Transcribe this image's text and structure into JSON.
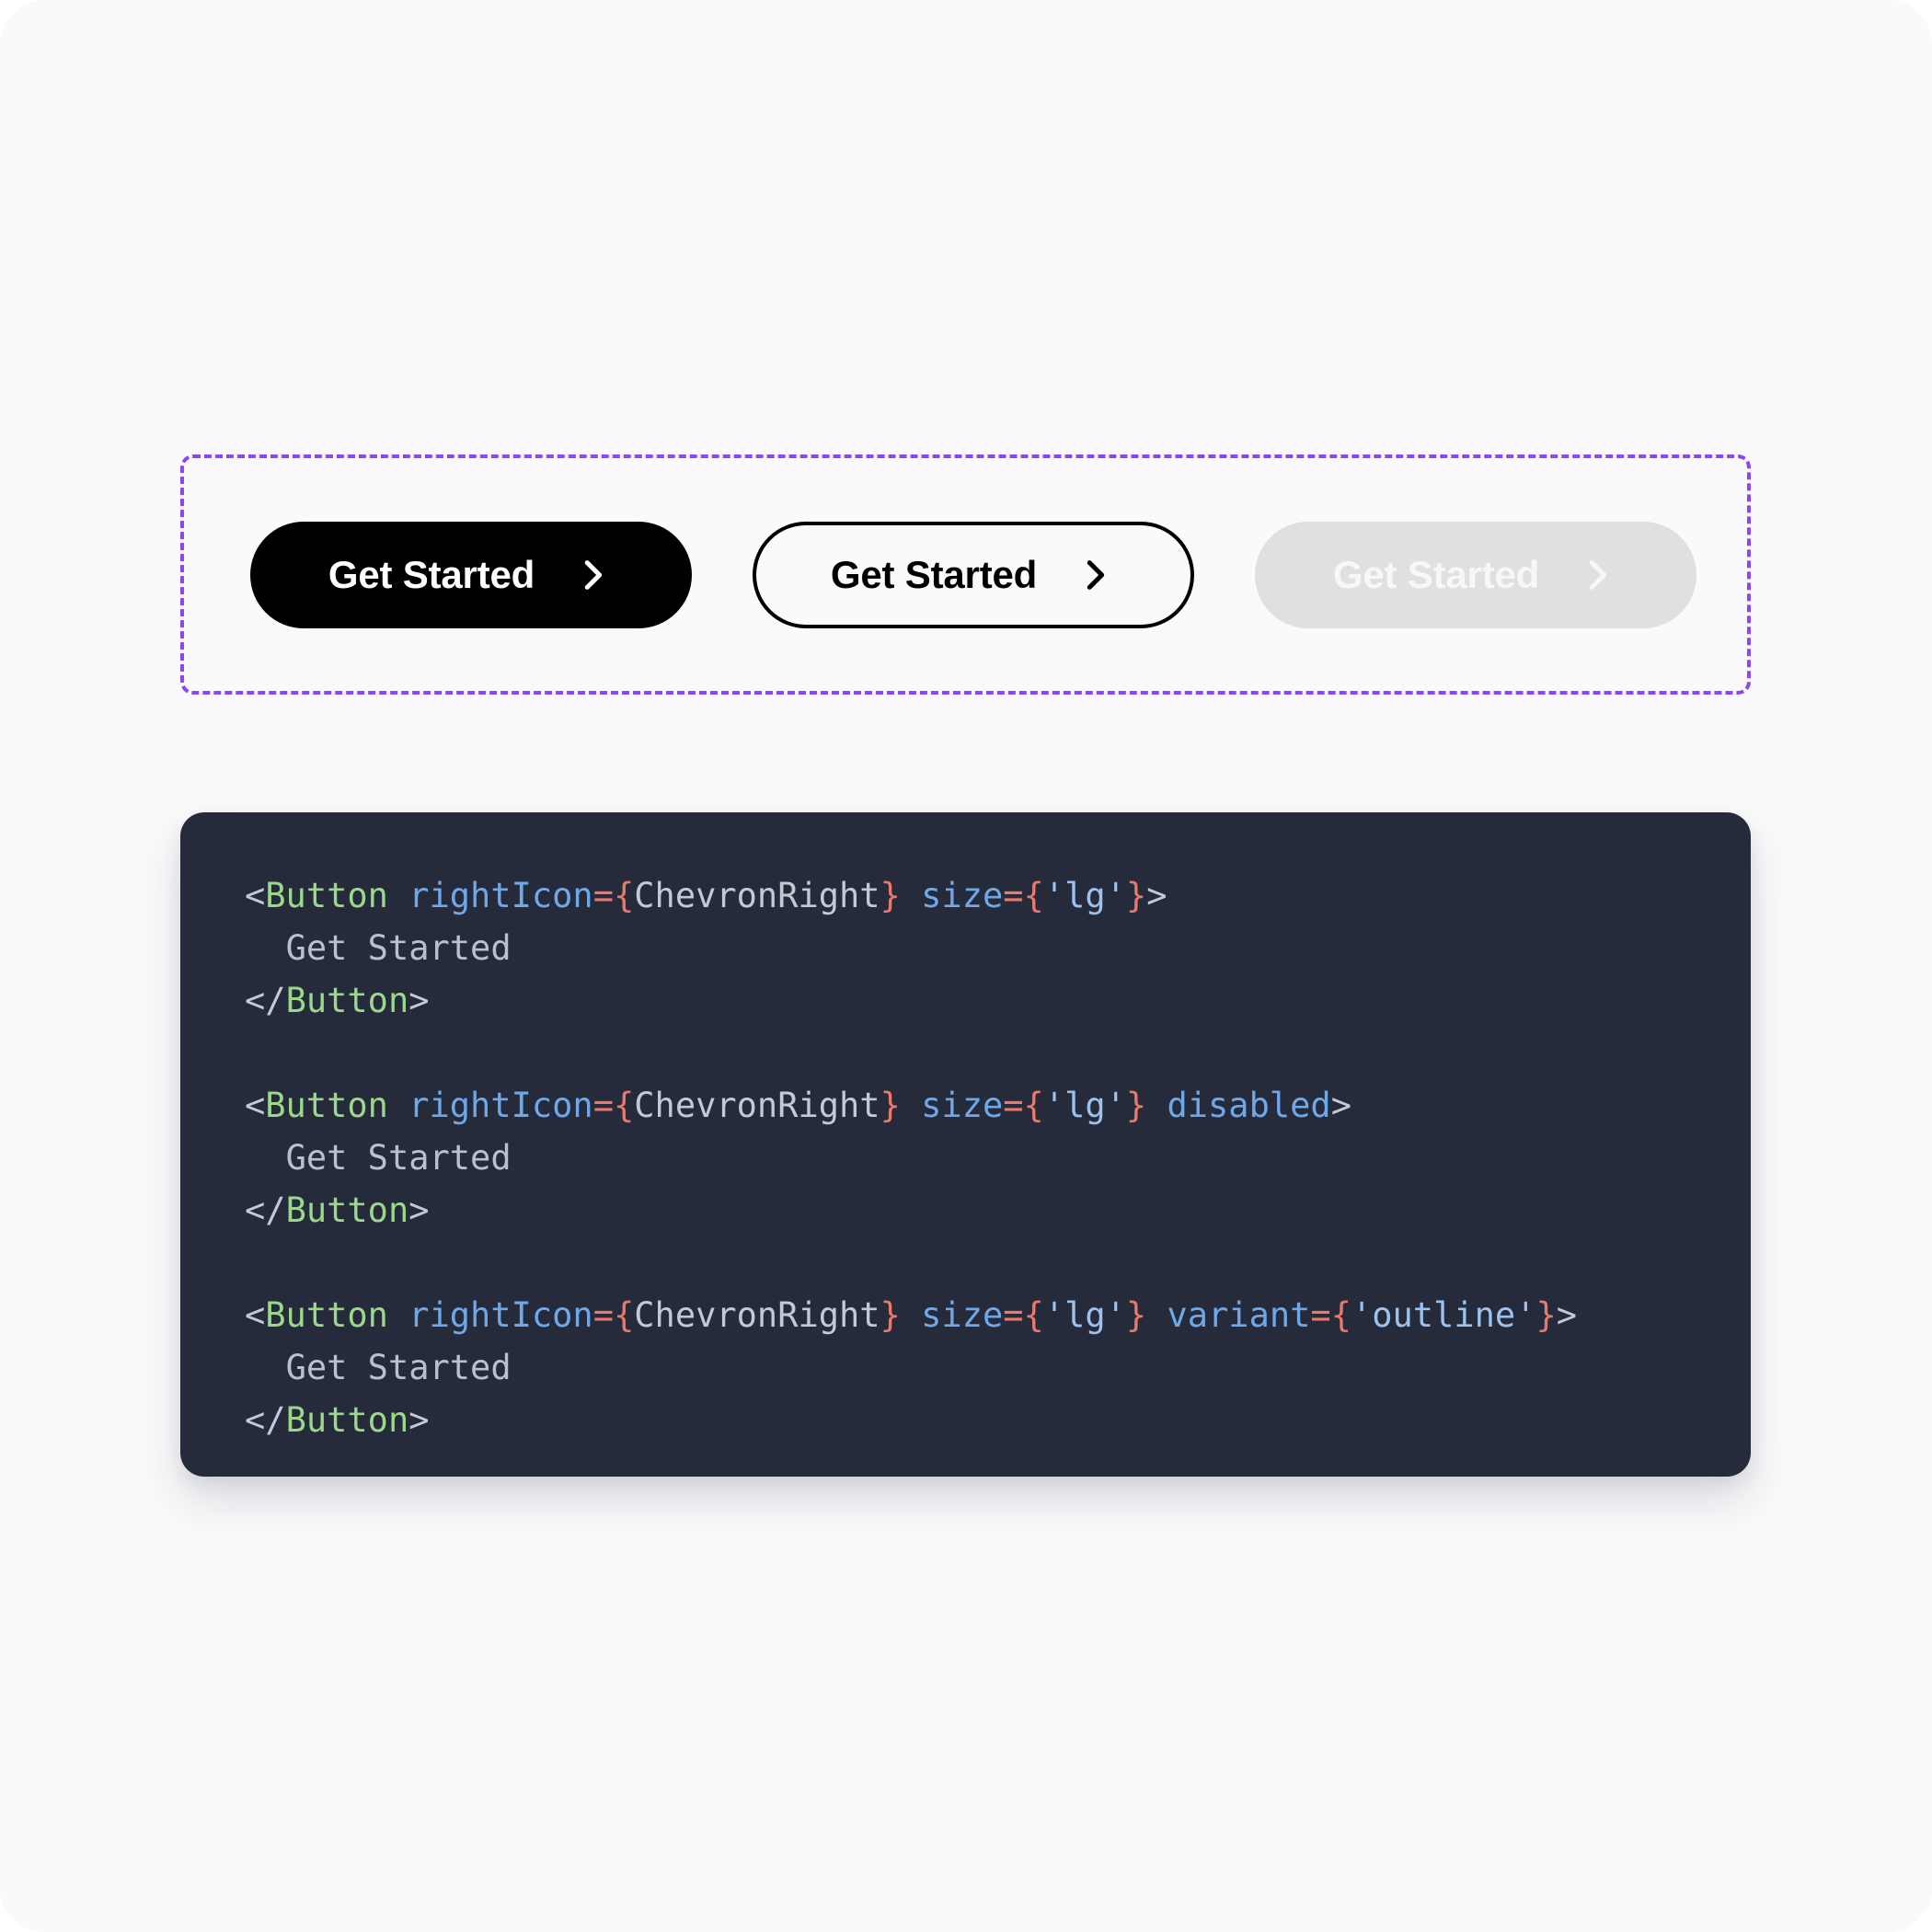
{
  "page": {
    "background_color": "#FAFAFC",
    "card_radius_px": 48
  },
  "preview": {
    "region_name": "component-preview",
    "border_color": "#8B46F5",
    "border_style": "dashed",
    "buttons": [
      {
        "label": "Get Started",
        "variant": "solid",
        "state": "default",
        "icon": "chevron-right-icon",
        "background_color": "#000000",
        "text_color": "#FFFFFF"
      },
      {
        "label": "Get Started",
        "variant": "outline",
        "state": "default",
        "icon": "chevron-right-icon",
        "background_color": "transparent",
        "text_color": "#000000",
        "border_color": "#000000"
      },
      {
        "label": "Get Started",
        "variant": "solid",
        "state": "disabled",
        "icon": "chevron-right-icon",
        "background_color": "#E0E0E0",
        "text_color": "#F7F7F8"
      }
    ]
  },
  "code": {
    "language": "jsx",
    "background_color": "#252B3A",
    "colors": {
      "tag": "#9BD88A",
      "attribute": "#6FA8E8",
      "equals": "#E8796B",
      "brace": "#E8796B",
      "string": "#9CC2F0",
      "punctuation": "#C3CAD6",
      "text": "#B9C0CE"
    },
    "snippets": [
      {
        "open_punc": "<",
        "tag": "Button",
        "attrs": [
          {
            "name": "rightIcon",
            "eq": "=",
            "open": "{",
            "value": "ChevronRight",
            "value_kind": "identifier",
            "close": "}"
          },
          {
            "name": "size",
            "eq": "=",
            "open": "{",
            "value": "'lg'",
            "value_kind": "string",
            "close": "}"
          }
        ],
        "bare_attrs": [],
        "close_punc": ">",
        "children": "Get Started",
        "closing": "</Button>"
      },
      {
        "open_punc": "<",
        "tag": "Button",
        "attrs": [
          {
            "name": "rightIcon",
            "eq": "=",
            "open": "{",
            "value": "ChevronRight",
            "value_kind": "identifier",
            "close": "}"
          },
          {
            "name": "size",
            "eq": "=",
            "open": "{",
            "value": "'lg'",
            "value_kind": "string",
            "close": "}"
          }
        ],
        "bare_attrs": [
          "disabled"
        ],
        "close_punc": ">",
        "children": "Get Started",
        "closing": "</Button>"
      },
      {
        "open_punc": "<",
        "tag": "Button",
        "attrs": [
          {
            "name": "rightIcon",
            "eq": "=",
            "open": "{",
            "value": "ChevronRight",
            "value_kind": "identifier",
            "close": "}"
          },
          {
            "name": "size",
            "eq": "=",
            "open": "{",
            "value": "'lg'",
            "value_kind": "string",
            "close": "}"
          },
          {
            "name": "variant",
            "eq": "=",
            "open": "{",
            "value": "'outline'",
            "value_kind": "string",
            "close": "}"
          }
        ],
        "bare_attrs": [],
        "close_punc": ">",
        "children": "Get Started",
        "closing": "</Button>"
      }
    ]
  }
}
